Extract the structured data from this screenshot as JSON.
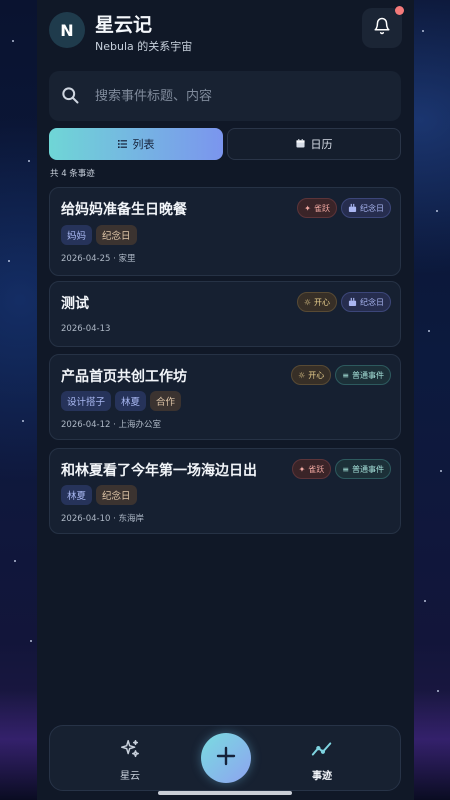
{
  "header": {
    "avatar_letter": "N",
    "title": "星云记",
    "subtitle": "Nebula 的关系宇宙"
  },
  "search": {
    "placeholder": "搜索事件标题、内容"
  },
  "view_toggle": {
    "list_label": "列表",
    "calendar_label": "日历",
    "selected": "列表"
  },
  "count_text": "共 4 条事迹",
  "events": [
    {
      "title": "给妈妈准备生日晚餐",
      "badges": [
        {
          "label": "雀跃",
          "icon": "sparkle-icon"
        },
        {
          "label": "纪念日",
          "icon": "gift-icon"
        }
      ],
      "tags": [
        "妈妈",
        "纪念日"
      ],
      "meta": "2026-04-25 · 家里"
    },
    {
      "title": "测试",
      "badges": [
        {
          "label": "开心",
          "icon": "sun-icon"
        },
        {
          "label": "纪念日",
          "icon": "gift-icon"
        }
      ],
      "tags": [],
      "meta": "2026-04-13"
    },
    {
      "title": "产品首页共创工作坊",
      "badges": [
        {
          "label": "开心",
          "icon": "sun-icon"
        },
        {
          "label": "普通事件",
          "icon": "lines-icon"
        }
      ],
      "tags": [
        "设计搭子",
        "林夏",
        "合作"
      ],
      "meta": "2026-04-12 · 上海办公室"
    },
    {
      "title": "和林夏看了今年第一场海边日出",
      "badges": [
        {
          "label": "雀跃",
          "icon": "sparkle-icon"
        },
        {
          "label": "普通事件",
          "icon": "lines-icon"
        }
      ],
      "tags": [
        "林夏",
        "纪念日"
      ],
      "meta": "2026-04-10 · 东海岸"
    }
  ],
  "bottom_nav": {
    "left_label": "星云",
    "right_label": "事迹",
    "active": "事迹"
  },
  "colors": {
    "accent_start": "#6fd6d6",
    "accent_end": "#7b95ee",
    "notification_dot": "#f47a7a"
  }
}
